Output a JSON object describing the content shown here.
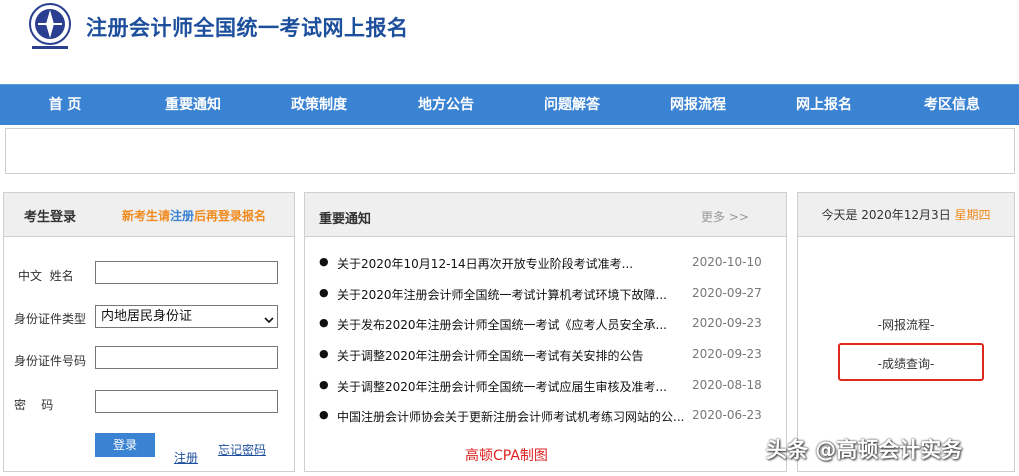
{
  "header": {
    "site_title": "注册会计师全国统一考试网上报名"
  },
  "nav": {
    "items": [
      "首 页",
      "重要通知",
      "政策制度",
      "地方公告",
      "问题解答",
      "网报流程",
      "网上报名",
      "考区信息"
    ]
  },
  "login": {
    "title": "考生登录",
    "register_hint_pre": "新考生请",
    "register_hint_link": "注册",
    "register_hint_post": "后再登录报名",
    "labels": {
      "name": "中文  姓名",
      "id_type": "身份证件类型",
      "id_number": "身份证件号码",
      "password": "密    码"
    },
    "id_type_value": "内地居民身份证",
    "login_button": "登录",
    "register_link": "注册",
    "forgot_link": "忘记密码"
  },
  "notice": {
    "title": "重要通知",
    "more": "更多 >>",
    "items": [
      {
        "title": "关于2020年10月12-14日再次开放专业阶段考试准考...",
        "date": "2020-10-10"
      },
      {
        "title": "关于2020年注册会计师全国统一考试计算机考试环境下故障...",
        "date": "2020-09-27"
      },
      {
        "title": "关于发布2020年注册会计师全国统一考试《应考人员安全承...",
        "date": "2020-09-23"
      },
      {
        "title": "关于调整2020年注册会计师全国统一考试有关安排的公告",
        "date": "2020-09-23"
      },
      {
        "title": "关于调整2020年注册会计师全国统一考试应届生审核及准考...",
        "date": "2020-08-18"
      },
      {
        "title": "中国注册会计师协会关于更新注册会计师考试机考练习网站的公...",
        "date": "2020-06-23"
      }
    ],
    "watermark": "高顿CPA制图"
  },
  "side": {
    "today_prefix": "今天是 2020年12月3日",
    "weekday": "星期四",
    "flow_link": "-网报流程-",
    "score_link": "-成绩查询-"
  },
  "watermark_bottom": "头条 @高顿会计实务",
  "colors": {
    "nav": "#3a82d2",
    "title": "#1d4f9c",
    "accent": "#f08a1c",
    "highlight": "#e0291e"
  }
}
